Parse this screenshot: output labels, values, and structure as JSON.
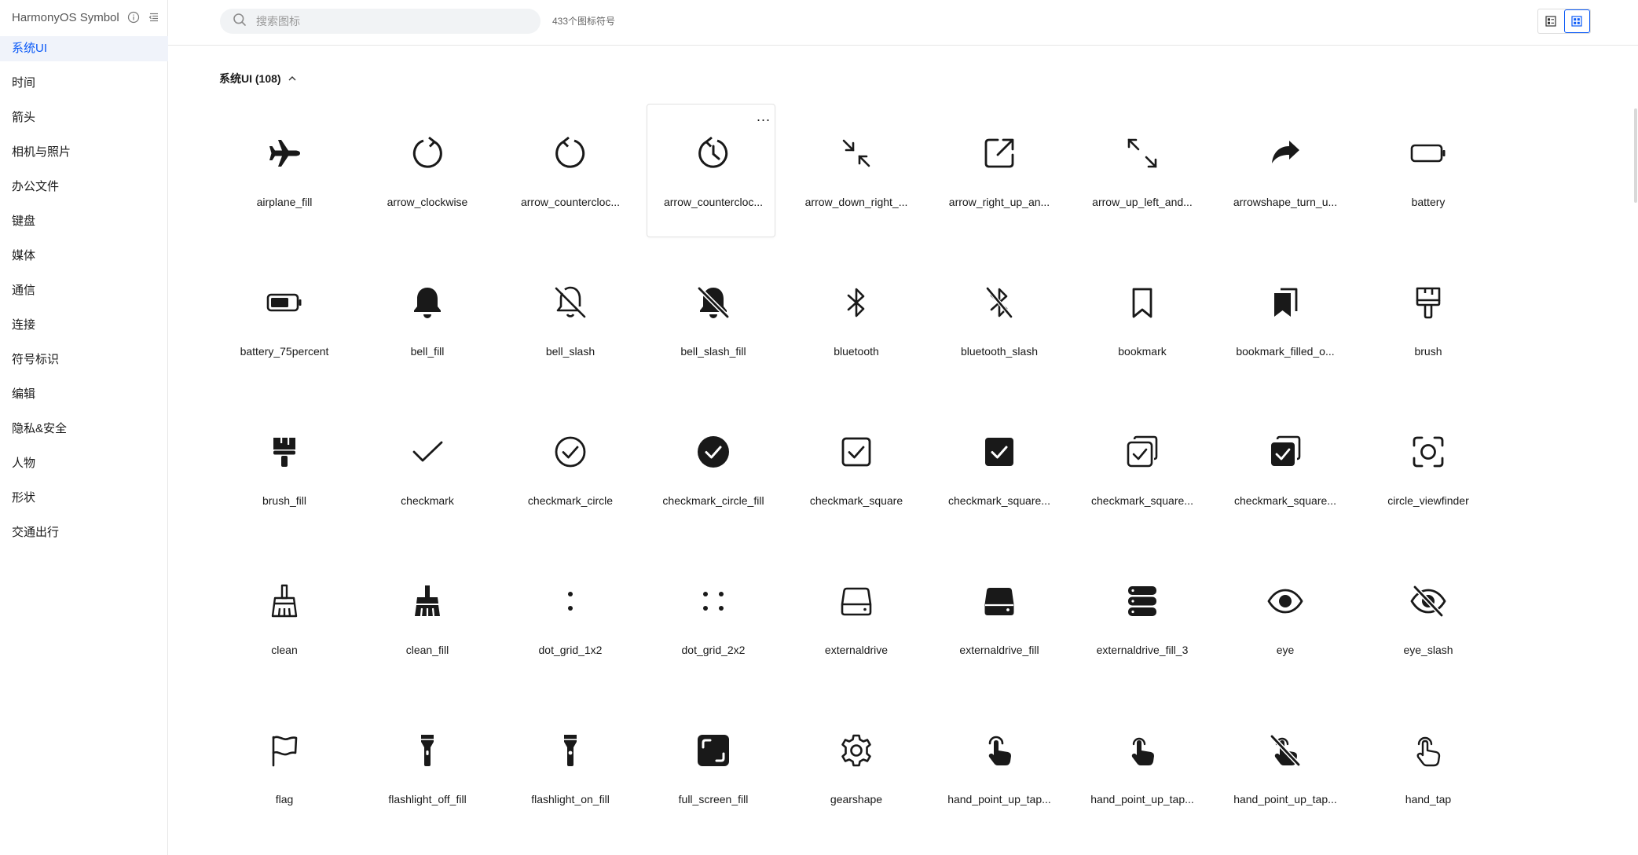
{
  "app": {
    "title": "HarmonyOS Symbol"
  },
  "sidebar": {
    "items": [
      {
        "label": "系统UI",
        "active": true
      },
      {
        "label": "时间"
      },
      {
        "label": "箭头"
      },
      {
        "label": "相机与照片"
      },
      {
        "label": "办公文件"
      },
      {
        "label": "键盘"
      },
      {
        "label": "媒体"
      },
      {
        "label": "通信"
      },
      {
        "label": "连接"
      },
      {
        "label": "符号标识"
      },
      {
        "label": "编辑"
      },
      {
        "label": "隐私&安全"
      },
      {
        "label": "人物"
      },
      {
        "label": "形状"
      },
      {
        "label": "交通出行"
      }
    ]
  },
  "search": {
    "placeholder": "搜索图标",
    "count": "433个图标符号"
  },
  "section": {
    "title": "系统UI (108)"
  },
  "icons": [
    {
      "name": "airplane_fill"
    },
    {
      "name": "arrow_clockwise"
    },
    {
      "name": "arrow_countercloc..."
    },
    {
      "name": "arrow_countercloc...",
      "more": "..."
    },
    {
      "name": "arrow_down_right_..."
    },
    {
      "name": "arrow_right_up_an..."
    },
    {
      "name": "arrow_up_left_and..."
    },
    {
      "name": "arrowshape_turn_u..."
    },
    {
      "name": "battery"
    },
    {
      "name": "battery_75percent"
    },
    {
      "name": "bell_fill"
    },
    {
      "name": "bell_slash"
    },
    {
      "name": "bell_slash_fill"
    },
    {
      "name": "bluetooth"
    },
    {
      "name": "bluetooth_slash"
    },
    {
      "name": "bookmark"
    },
    {
      "name": "bookmark_filled_o..."
    },
    {
      "name": "brush"
    },
    {
      "name": "brush_fill"
    },
    {
      "name": "checkmark"
    },
    {
      "name": "checkmark_circle"
    },
    {
      "name": "checkmark_circle_fill"
    },
    {
      "name": "checkmark_square"
    },
    {
      "name": "checkmark_square..."
    },
    {
      "name": "checkmark_square..."
    },
    {
      "name": "checkmark_square..."
    },
    {
      "name": "circle_viewfinder"
    },
    {
      "name": "clean"
    },
    {
      "name": "clean_fill"
    },
    {
      "name": "dot_grid_1x2"
    },
    {
      "name": "dot_grid_2x2"
    },
    {
      "name": "externaldrive"
    },
    {
      "name": "externaldrive_fill"
    },
    {
      "name": "externaldrive_fill_3"
    },
    {
      "name": "eye"
    },
    {
      "name": "eye_slash"
    },
    {
      "name": "flag"
    },
    {
      "name": "flashlight_off_fill"
    },
    {
      "name": "flashlight_on_fill"
    },
    {
      "name": "full_screen_fill"
    },
    {
      "name": "gearshape"
    },
    {
      "name": "hand_point_up_tap..."
    },
    {
      "name": "hand_point_up_tap..."
    },
    {
      "name": "hand_point_up_tap..."
    },
    {
      "name": "hand_tap"
    }
  ]
}
